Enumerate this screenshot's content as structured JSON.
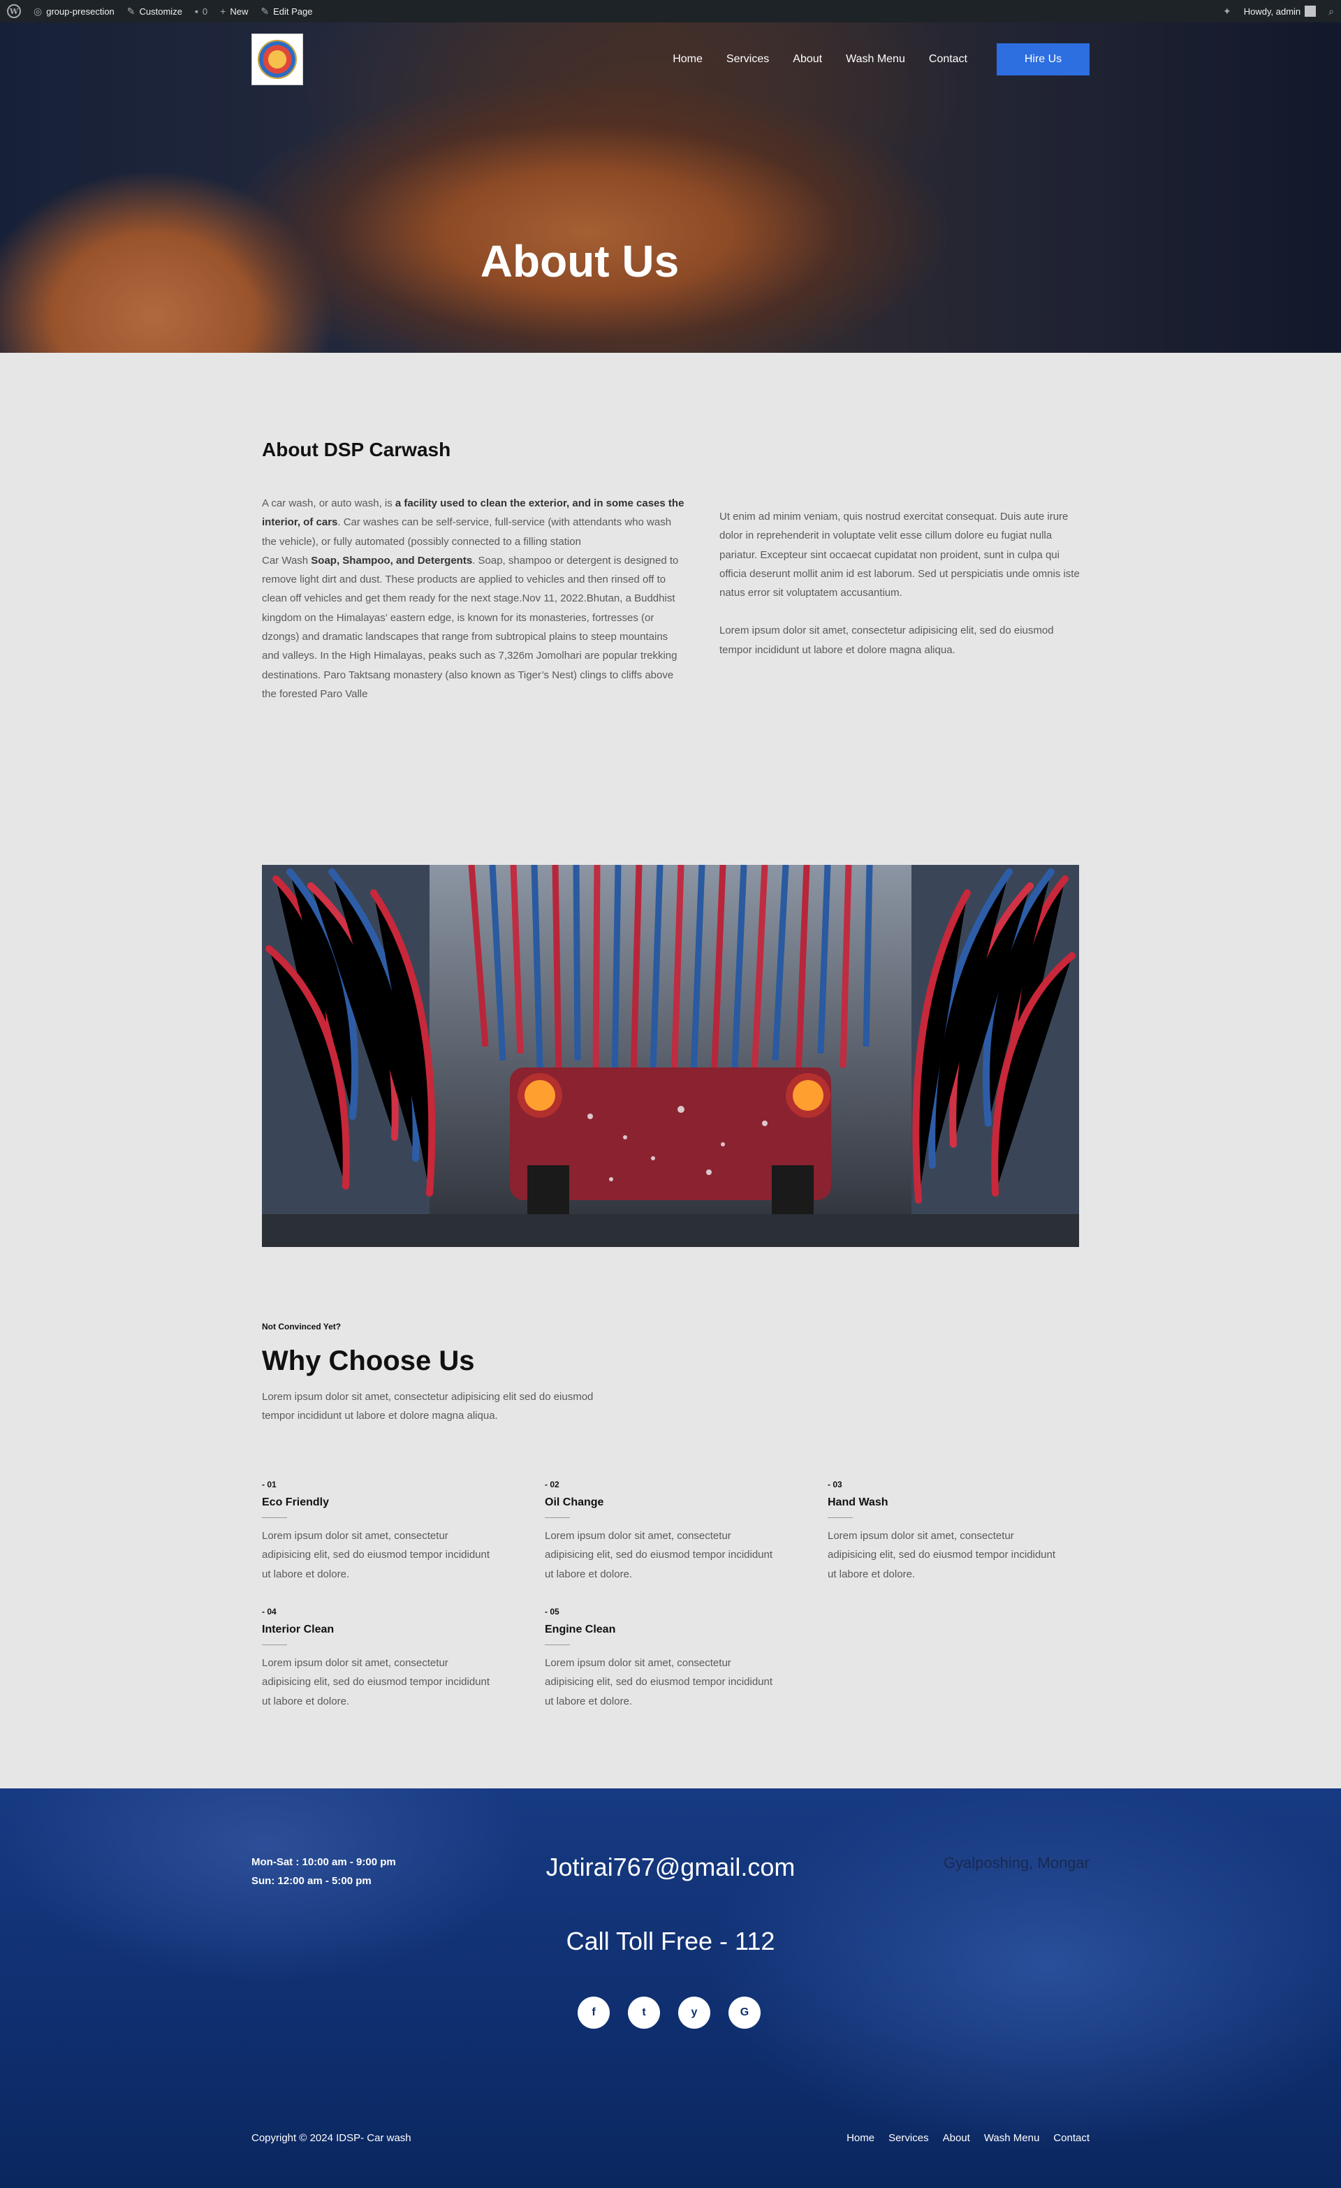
{
  "admin_bar": {
    "site_name": "group-presection",
    "customize": "Customize",
    "comments_count": "0",
    "new": "New",
    "edit_page": "Edit Page",
    "howdy": "Howdy, admin"
  },
  "header": {
    "nav": [
      "Home",
      "Services",
      "About",
      "Wash Menu",
      "Contact"
    ],
    "cta": "Hire Us"
  },
  "hero": {
    "title": "About Us"
  },
  "about": {
    "heading": "About DSP Carwash",
    "left": {
      "intro_pre": "A car wash, or auto wash, is ",
      "intro_bold": "a facility used to clean the exterior, and in some cases the interior, of cars",
      "intro_post": ". Car washes can be self-service, full-service (with attendants who wash the vehicle), or fully automated (possibly connected to a filling station",
      "p2_pre": "Car Wash ",
      "p2_bold": "Soap, Shampoo, and Detergents",
      "p2_post": ". Soap, shampoo or detergent is designed to remove light dirt and dust. These products are applied to vehicles and then rinsed off to clean off vehicles and get them ready for the next stage.Nov 11, 2022.Bhutan, a Buddhist kingdom on the Himalayas’ eastern edge, is known for its monasteries, fortresses (or dzongs) and dramatic landscapes that range from subtropical plains to steep mountains and valleys. In the High Himalayas, peaks such as 7,326m Jomolhari are popular trekking destinations. Paro Taktsang monastery (also known as Tiger’s Nest) clings to cliffs above the forested Paro Valle"
    },
    "right": {
      "p1": "Ut enim ad minim veniam, quis nostrud exercitat consequat. Duis aute irure dolor in reprehenderit in voluptate velit esse cillum dolore eu fugiat nulla pariatur. Excepteur sint occaecat cupidatat non proident, sunt in culpa qui officia deserunt mollit anim id est laborum. Sed ut perspiciatis unde omnis iste natus error sit voluptatem accusantium.",
      "p2": "Lorem ipsum dolor sit amet, consectetur adipisicing elit, sed do eiusmod tempor incididunt ut labore et dolore magna aliqua."
    }
  },
  "why": {
    "eyebrow": "Not Convinced Yet?",
    "heading": "Why Choose Us",
    "sub": "Lorem ipsum dolor sit amet, consectetur adipisicing elit sed do eiusmod tempor incididunt ut labore et dolore magna aliqua.",
    "features": [
      {
        "num": "- 01",
        "title": "Eco Friendly",
        "desc": "Lorem ipsum dolor sit amet, consectetur adipisicing elit, sed do eiusmod tempor incididunt ut labore et dolore."
      },
      {
        "num": "- 02",
        "title": "Oil Change",
        "desc": "Lorem ipsum dolor sit amet, consectetur adipisicing elit, sed do eiusmod tempor incididunt ut labore et dolore."
      },
      {
        "num": "- 03",
        "title": "Hand Wash",
        "desc": "Lorem ipsum dolor sit amet, consectetur adipisicing elit, sed do eiusmod tempor incididunt ut labore et dolore."
      },
      {
        "num": "- 04",
        "title": "Interior Clean",
        "desc": "Lorem ipsum dolor sit amet, consectetur adipisicing elit, sed do eiusmod tempor incididunt ut labore et dolore."
      },
      {
        "num": "- 05",
        "title": "Engine Clean",
        "desc": "Lorem ipsum dolor sit amet, consectetur adipisicing elit, sed do eiusmod tempor incididunt ut labore et dolore."
      }
    ]
  },
  "footer": {
    "hours_weekday": "Mon-Sat : 10:00 am - 9:00 pm",
    "hours_sunday": "Sun: 12:00 am - 5:00 pm",
    "email": "Jotirai767@gmail.com",
    "address": "Gyalposhing, Mongar",
    "tollfree": "Call Toll Free - 112",
    "socials": [
      {
        "icon": "facebook-icon",
        "glyph": "f"
      },
      {
        "icon": "twitter-icon",
        "glyph": "t"
      },
      {
        "icon": "yelp-icon",
        "glyph": "y"
      },
      {
        "icon": "google-icon",
        "glyph": "G"
      }
    ],
    "copyright": "Copyright © 2024 IDSP- Car wash",
    "nav": [
      "Home",
      "Services",
      "About",
      "Wash Menu",
      "Contact"
    ]
  },
  "colors": {
    "accent": "#2d6ee0",
    "footer_bg": "#0f2f70",
    "page_bg": "#e6e6e6"
  }
}
